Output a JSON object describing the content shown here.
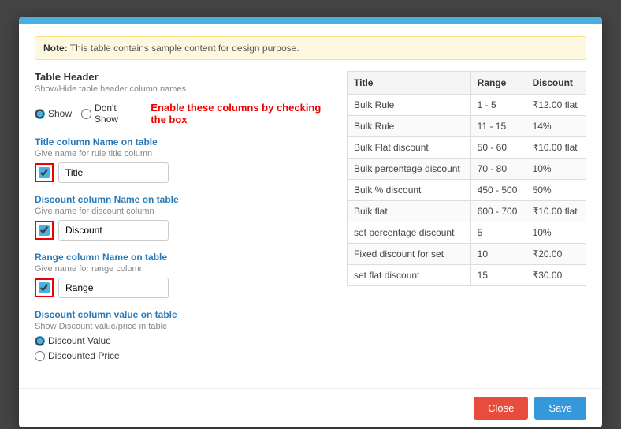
{
  "modal": {
    "top_bar_color": "#4ab0e0"
  },
  "note": {
    "prefix": "Note:",
    "text": " This table contains sample content for design purpose."
  },
  "left_panel": {
    "table_header": {
      "title": "Table Header",
      "desc": "Show/Hide table header column names",
      "show_label": "Show",
      "dont_show_label": "Don't Show",
      "enable_note": "Enable these columns by checking the box"
    },
    "title_column": {
      "label": "Title column Name on table",
      "desc": "Give name for rule title column",
      "value": "Title"
    },
    "discount_column": {
      "label": "Discount column Name on table",
      "desc": "Give name for discount column",
      "value": "Discount"
    },
    "range_column": {
      "label": "Range column Name on table",
      "desc": "Give name for range column",
      "value": "Range"
    },
    "discount_value": {
      "label": "Discount column value on table",
      "desc": "Show Discount value/price in table",
      "option1": "Discount Value",
      "option2": "Discounted Price"
    }
  },
  "table": {
    "headers": [
      "Title",
      "Range",
      "Discount"
    ],
    "rows": [
      [
        "Bulk Rule",
        "1 - 5",
        "₹12.00 flat"
      ],
      [
        "Bulk Rule",
        "11 - 15",
        "14%"
      ],
      [
        "Bulk Flat discount",
        "50 - 60",
        "₹10.00 flat"
      ],
      [
        "Bulk percentage discount",
        "70 - 80",
        "10%"
      ],
      [
        "Bulk % discount",
        "450 - 500",
        "50%"
      ],
      [
        "Bulk flat",
        "600 - 700",
        "₹10.00 flat"
      ],
      [
        "set percentage discount",
        "5",
        "10%"
      ],
      [
        "Fixed discount for set",
        "10",
        "₹20.00"
      ],
      [
        "set flat discount",
        "15",
        "₹30.00"
      ]
    ]
  },
  "footer": {
    "close_label": "Close",
    "save_label": "Save"
  }
}
